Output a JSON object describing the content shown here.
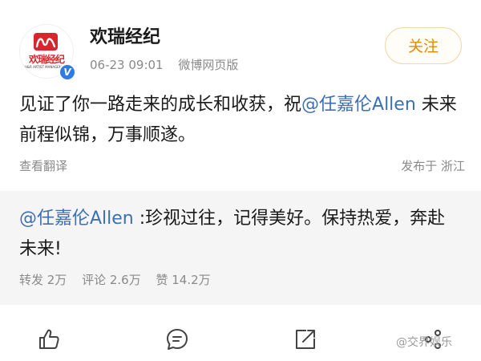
{
  "author": {
    "name": "欢瑞经纪",
    "logo_text": "欢瑞经纪",
    "logo_subtext": "H&R ARTIST MANAGEMENT",
    "verified_mark": "V"
  },
  "meta": {
    "timestamp": "06-23 09:01",
    "source": "微博网页版"
  },
  "follow_label": "关注",
  "post": {
    "text_before": "见证了你一路走来的成长和收获，祝",
    "mention": "@任嘉伦Allen",
    "text_after": " 未来前程似锦，万事顺遂。",
    "translate_label": "查看翻译",
    "location": "发布于 浙江"
  },
  "repost": {
    "mention": "@任嘉伦Allen",
    "text": " :珍视过往，记得美好。保持热爱，奔赴未来!",
    "stats": {
      "reposts": "转发 2万",
      "comments": "评论 2.6万",
      "likes": "赞 14.2万"
    }
  },
  "actions": {
    "icons": [
      "like-icon",
      "comment-icon",
      "share-icon",
      "more-icon"
    ]
  },
  "watermark": "@交界娱乐",
  "colors": {
    "mention": "#3e6fb3",
    "follow": "#e58a00",
    "verified": "#2d7be5",
    "brand": "#d7262c"
  }
}
